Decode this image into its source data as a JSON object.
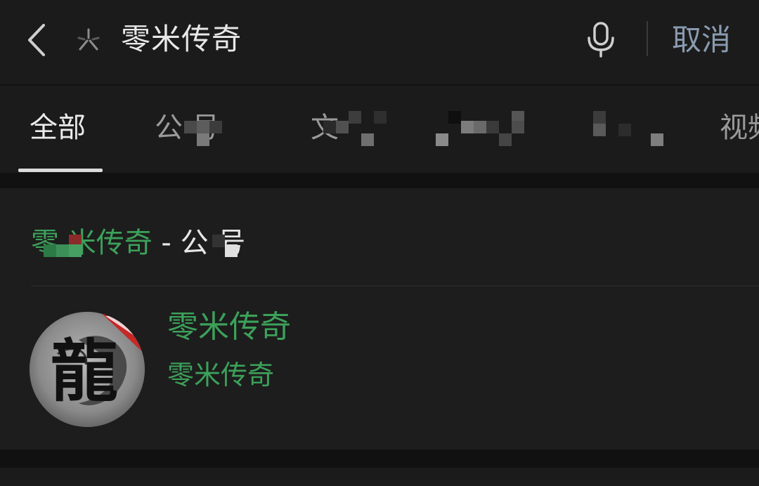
{
  "search": {
    "query": "零米传奇",
    "cancel_label": "取消"
  },
  "tabs": [
    {
      "label": "全部",
      "active": true
    },
    {
      "label": "公众号",
      "visible_text": "公  号"
    },
    {
      "label": "文章",
      "visible_text": "文"
    },
    {
      "label": "",
      "visible_text": ""
    },
    {
      "label": "",
      "visible_text": ""
    },
    {
      "label": "视频",
      "visible_text": "视频"
    }
  ],
  "section": {
    "title_highlight": "零米传奇",
    "title_rest": " - 公众号",
    "title_visible_highlight": "零 米传奇",
    "title_visible_rest": " - 公  号"
  },
  "account": {
    "name": "零米传奇",
    "subtitle": "零米传奇",
    "avatar_char": "龍"
  },
  "colors": {
    "background": "#191919",
    "highlight_green": "#3ca15a",
    "cancel_blue": "#8a9bb0"
  },
  "icons": [
    "back-arrow-icon",
    "search-icon",
    "microphone-icon"
  ]
}
